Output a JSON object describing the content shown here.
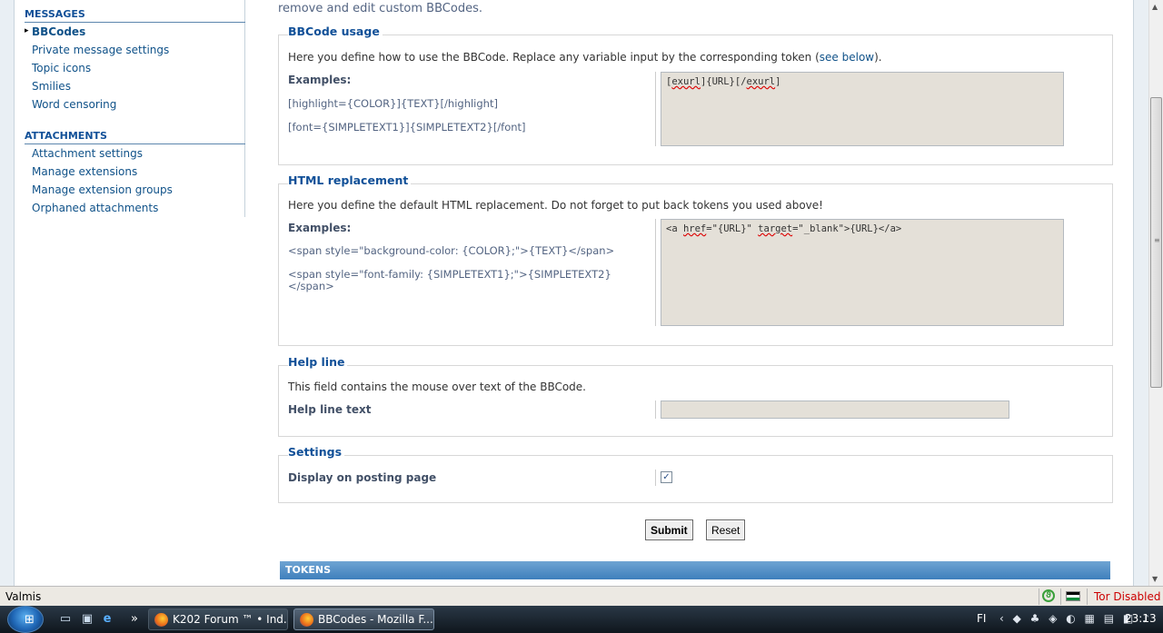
{
  "sidebar": {
    "messages_heading": "MESSAGES",
    "messages_items": [
      "BBCodes",
      "Private message settings",
      "Topic icons",
      "Smilies",
      "Word censoring"
    ],
    "attachments_heading": "ATTACHMENTS",
    "attachments_items": [
      "Attachment settings",
      "Manage extensions",
      "Manage extension groups",
      "Orphaned attachments"
    ]
  },
  "main": {
    "intro": "remove and edit custom BBCodes.",
    "usage": {
      "legend": "BBCode usage",
      "desc_before": "Here you define how to use the BBCode. Replace any variable input by the corresponding token (",
      "desc_link": "see below",
      "desc_after": ").",
      "examples_label": "Examples:",
      "example1": "[highlight={COLOR}]{TEXT}[/highlight]",
      "example2": "[font={SIMPLETEXT1}]{SIMPLETEXT2}[/font]",
      "value_a": "[",
      "value_b": "exurl",
      "value_c": "]{URL}[/",
      "value_d": "exurl",
      "value_e": "]"
    },
    "html": {
      "legend": "HTML replacement",
      "desc": "Here you define the default HTML replacement. Do not forget to put back tokens you used above!",
      "examples_label": "Examples:",
      "example1": "<span style=\"background-color: {COLOR};\">{TEXT}</span>",
      "example2": "<span style=\"font-family: {SIMPLETEXT1};\">{SIMPLETEXT2}</span>",
      "value_a": "<a ",
      "value_b": "href",
      "value_c": "=\"{URL}\" ",
      "value_d": "target",
      "value_e": "=\"_blank\">{URL}</a>"
    },
    "helpline": {
      "legend": "Help line",
      "desc": "This field contains the mouse over text of the BBCode.",
      "label": "Help line text",
      "value": ""
    },
    "settings": {
      "legend": "Settings",
      "label": "Display on posting page",
      "checked_mark": "✓"
    },
    "submit_label": "Submit",
    "reset_label": "Reset",
    "tokens_heading": "TOKENS"
  },
  "statusbar": {
    "text": "Valmis",
    "tor": "Tor Disabled"
  },
  "taskbar": {
    "tasks": [
      "K202 Forum ™ • Ind...",
      "BBCodes - Mozilla F..."
    ],
    "language": "FI",
    "clock": "23:13",
    "more_glyph": "»"
  },
  "colors": {
    "link": "#105289",
    "heading": "#115098",
    "textarea_bg": "#e4e0d8",
    "tor_red": "#cc0000"
  }
}
